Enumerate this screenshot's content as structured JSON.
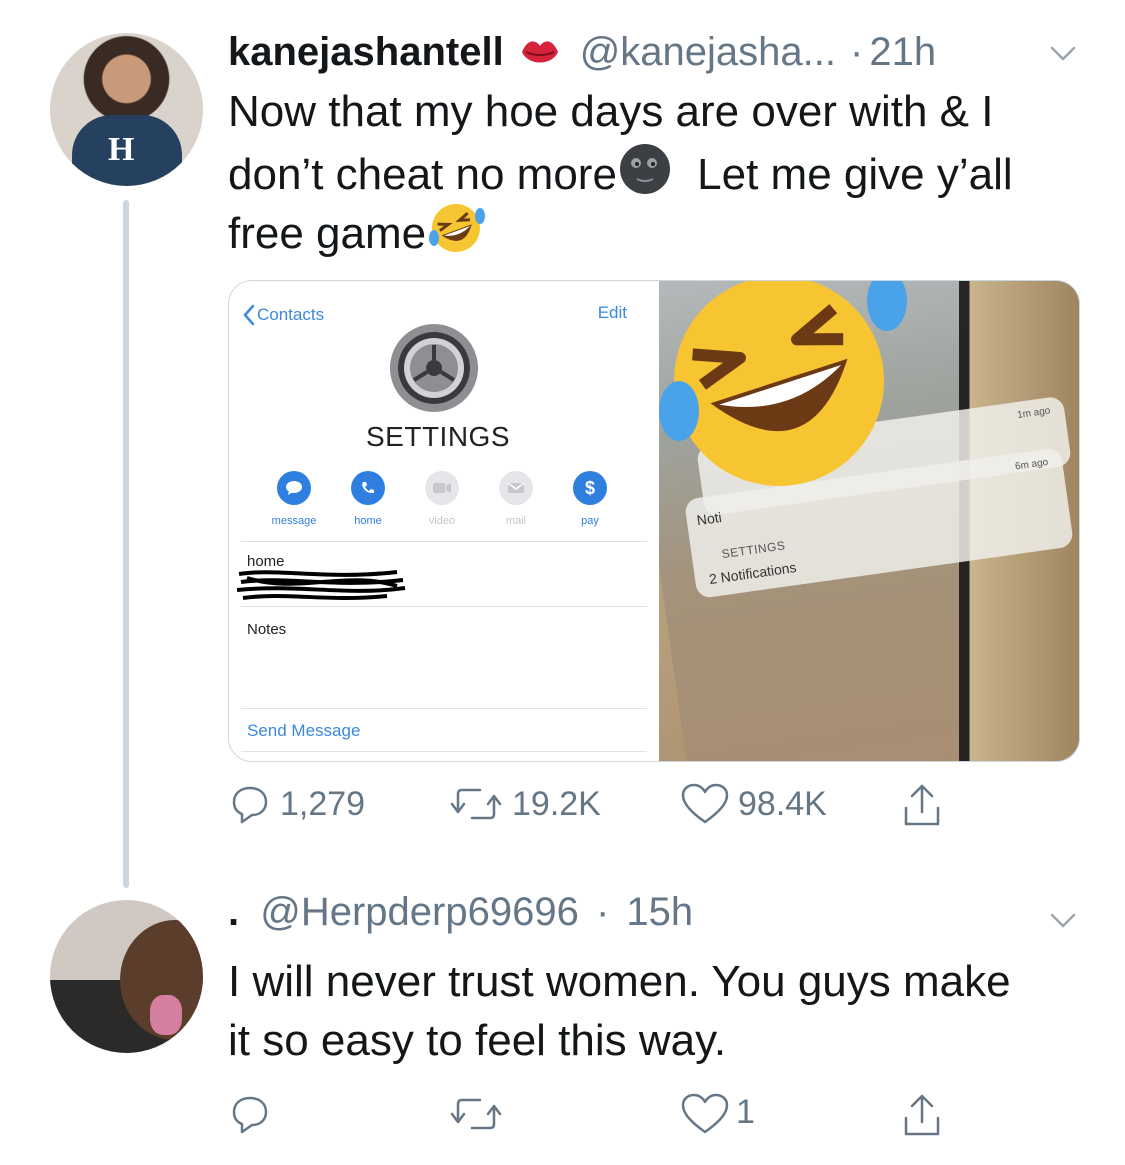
{
  "tweet1": {
    "display_name": "kanejashantell",
    "handle": "@kanejasha...",
    "time_sep": "·",
    "time": "21h",
    "text_line1": "Now that my hoe days are over with & I",
    "text_line2a": "don’t cheat no more",
    "text_line2b": "Let me give y’all",
    "text_line3": "free game",
    "media": {
      "contact": {
        "back_label": "Contacts",
        "edit_label": "Edit",
        "name": "SETTINGS",
        "actions": [
          "message",
          "home",
          "video",
          "mail",
          "pay"
        ],
        "home_label": "home",
        "notes_label": "Notes",
        "send_message": "Send Message"
      },
      "lockscreen": {
        "notif1_time": "1m ago",
        "notif2_time": "6m ago",
        "notif_partial": "Noti",
        "app_name": "SETTINGS",
        "notif_count": "2 Notifications"
      }
    },
    "stats": {
      "replies": "1,279",
      "retweets": "19.2K",
      "likes": "98.4K"
    }
  },
  "tweet2": {
    "display_name": ".",
    "handle": "@Herpderp69696",
    "time_sep": "·",
    "time": "15h",
    "text_line1": "I will never trust women. You guys make",
    "text_line2": "it so easy to feel this way.",
    "stats": {
      "likes": "1"
    }
  },
  "colors": {
    "text": "#14171a",
    "secondary": "#657786",
    "thread_line": "#ccd6dd",
    "ios_blue": "#3b88e0"
  }
}
